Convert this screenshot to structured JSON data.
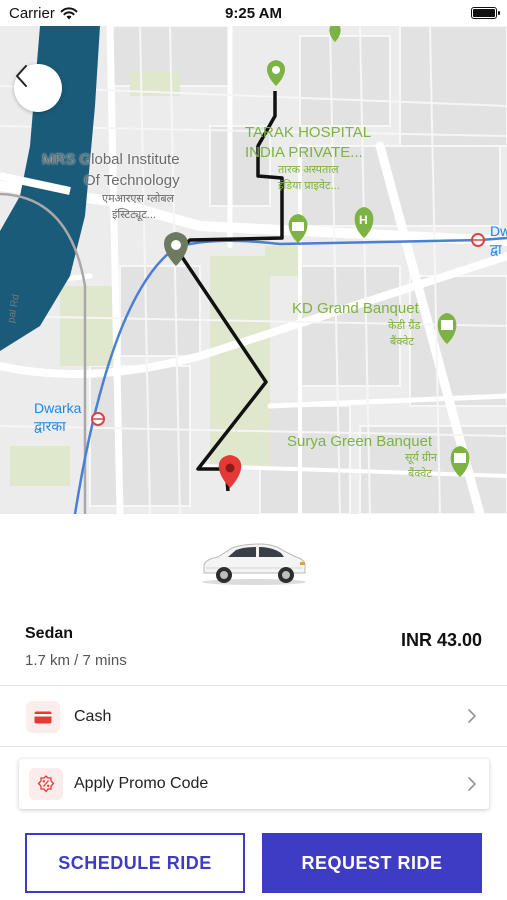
{
  "status_bar": {
    "carrier": "Carrier",
    "time": "9:25 AM"
  },
  "map": {
    "labels": {
      "tarak_hospital_en_1": "TARAK HOSPITAL",
      "tarak_hospital_en_2": "INDIA PRIVATE...",
      "tarak_hospital_hi_1": "तारक अस्पताल",
      "tarak_hospital_hi_2": "इंडिया प्राइवेट...",
      "mrs_institute_en_1": "MRS Global Institute",
      "mrs_institute_en_2": "Of Technology",
      "mrs_institute_hi_1": "एमआरएस ग्लोबल",
      "mrs_institute_hi_2": "इंस्टिट्यूट...",
      "kd_grand_en": "KD Grand Banquet",
      "kd_grand_hi_1": "केडी ग्रैंड",
      "kd_grand_hi_2": "बैंक्वेट",
      "surya_green_en": "Surya Green Banquet",
      "surya_green_hi_1": "सूर्य ग्रीन",
      "surya_green_hi_2": "बैंक्वेट",
      "dwarka_en": "Dwarka",
      "dwarka_hi": "द्वारका",
      "dw_right_en": "Dw",
      "dw_right_hi": "द्वा",
      "road_name": "pal Rd"
    }
  },
  "ride": {
    "type": "Sedan",
    "meta": "1.7 km / 7 mins",
    "price": "INR 43.00"
  },
  "payment": {
    "label": "Cash"
  },
  "promo": {
    "label": "Apply Promo Code"
  },
  "actions": {
    "schedule": "SCHEDULE RIDE",
    "request": "REQUEST RIDE"
  },
  "colors": {
    "accent": "#3f3cc4",
    "route": "#111111",
    "metro_line": "#4a7fd6",
    "water": "#1b5b7a",
    "park": "#dfe8cc",
    "poi_green": "#7cb342",
    "destination_pin": "#e53935",
    "pickup_pin": "#6d7a5f"
  },
  "icons": {
    "back": "chevron-left-icon",
    "wifi": "wifi-icon",
    "battery": "battery-icon",
    "car": "sedan-car-icon",
    "cash": "credit-card-icon",
    "promo": "percent-badge-icon",
    "chevron": "chevron-right-icon"
  }
}
